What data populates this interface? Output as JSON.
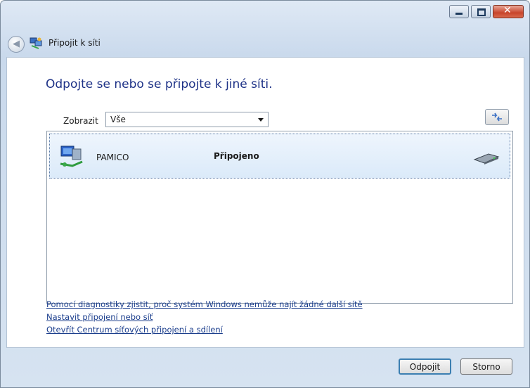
{
  "window": {
    "title": "Připojit k síti"
  },
  "heading": "Odpojte se nebo se připojte k jiné síti.",
  "filter": {
    "label": "Zobrazit",
    "selected": "Vše"
  },
  "networks": [
    {
      "name": "PAMICO",
      "status": "Připojeno",
      "icon": "network-computer-icon",
      "signal_icon": "wired-connection-icon"
    }
  ],
  "links": [
    "Pomocí diagnostiky zjistit, proč systém Windows nemůže najít žádné další sítě",
    "Nastavit připojení nebo síť",
    "Otevřít Centrum síťových připojení a sdílení"
  ],
  "buttons": {
    "disconnect": "Odpojit",
    "cancel": "Storno"
  }
}
